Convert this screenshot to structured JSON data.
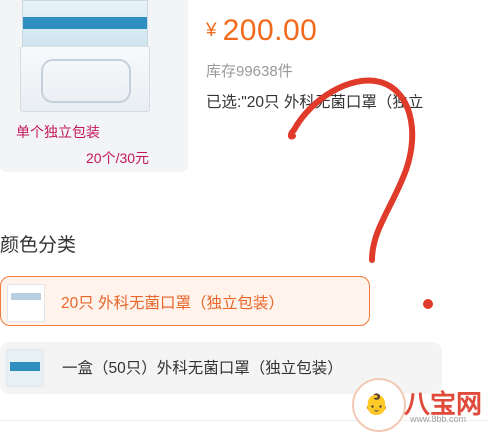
{
  "product": {
    "thumb_caption": "单个独立包装",
    "thumb_price": "20个/30元",
    "currency": "¥",
    "price": "200.00",
    "stock": "库存99638件",
    "selected": "已选:\"20只 外科无菌口罩（独立"
  },
  "color_section": {
    "title": "颜色分类",
    "options": [
      {
        "label": "20只 外科无菌口罩（独立包装）",
        "selected": true
      },
      {
        "label": "一盒（50只）外科无菌口罩（独立包装）",
        "selected": false
      }
    ]
  },
  "watermark": {
    "brand": "八宝网",
    "url": "www.8bb.com"
  },
  "colors": {
    "accent": "#f26a1b",
    "selected_border": "#f07a3d",
    "annotation_red": "#e03a2a"
  }
}
